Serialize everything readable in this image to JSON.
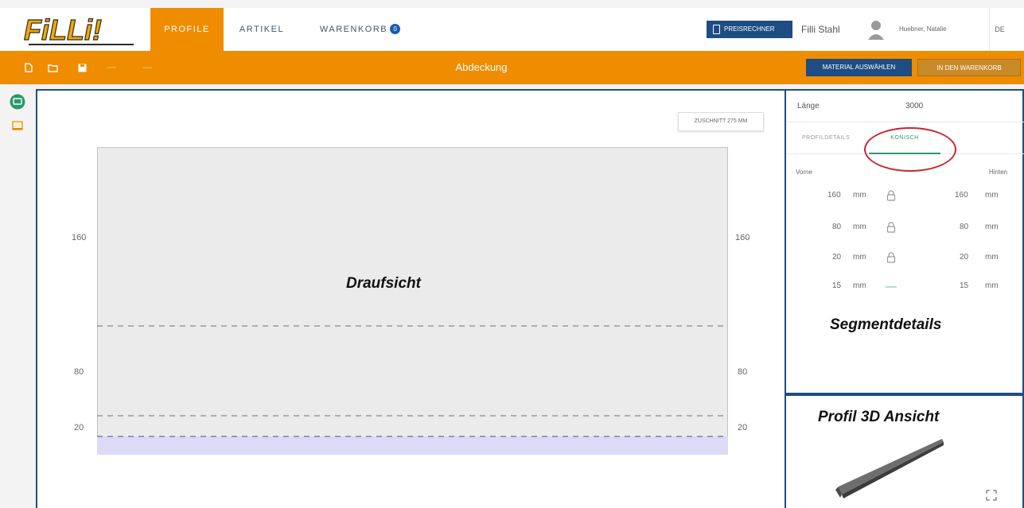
{
  "nav": {
    "logo": "FiLLi!",
    "tabs": [
      {
        "label": "PROFILE",
        "active": true
      },
      {
        "label": "ARTIKEL",
        "active": false
      },
      {
        "label": "WARENKORB",
        "active": false,
        "badge": "0"
      }
    ],
    "preisrechner_label": "PREISRECHNER",
    "company": "Filli Stahl",
    "user": "Huebner, Natalie",
    "language": "DE"
  },
  "toolbar": {
    "title": "Abdeckung",
    "icons": [
      "new-file-icon",
      "open-folder-icon",
      "save-icon"
    ],
    "material_button": "MATERIAL AUSWÄHLEN",
    "warenkorb_button": "IN DEN WARENKORB"
  },
  "drawing": {
    "zuschnitt_label": "ZUSCHNITT 275 MM",
    "label_160_left": "160",
    "label_80_left": "80",
    "label_20_left": "20",
    "label_160_right": "160",
    "label_80_right": "80",
    "label_20_right": "20",
    "view_title": "Draufsicht"
  },
  "segment": {
    "laenge_label": "Länge",
    "laenge_value": "3000",
    "tabs": [
      {
        "label": "PROFILDETAILS",
        "active": false
      },
      {
        "label": "KONISCH",
        "active": true
      }
    ],
    "col_vorne": "Vorne",
    "col_hinten": "Hinten",
    "rows": [
      {
        "vorne": "160",
        "unit_v": "mm",
        "lock": "lock-icon",
        "hinten": "160",
        "unit_h": "mm"
      },
      {
        "vorne": "80",
        "unit_v": "mm",
        "lock": "lock-icon",
        "hinten": "80",
        "unit_h": "mm"
      },
      {
        "vorne": "20",
        "unit_v": "mm",
        "lock": "lock-icon",
        "hinten": "20",
        "unit_h": "mm"
      },
      {
        "vorne": "15",
        "unit_v": "mm",
        "lock": "dash-icon",
        "hinten": "15",
        "unit_h": "mm"
      }
    ],
    "title": "Segmentdetails"
  },
  "view3d": {
    "title": "Profil 3D Ansicht"
  },
  "colors": {
    "brand_orange": "#f08c00",
    "navy": "#1d4d82",
    "accent_green": "#2a9a6a"
  }
}
